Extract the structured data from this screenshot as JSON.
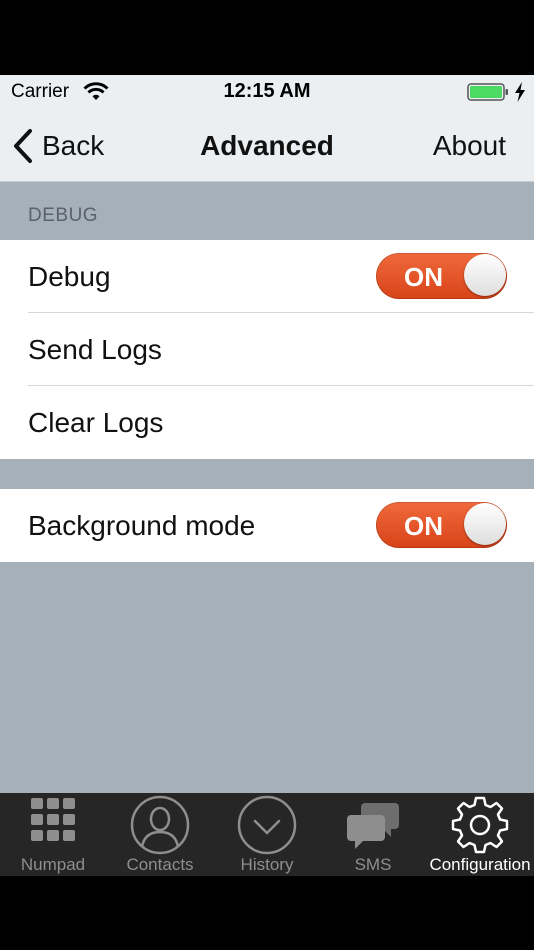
{
  "status": {
    "carrier": "Carrier",
    "time": "12:15 AM"
  },
  "nav": {
    "back_label": "Back",
    "title": "Advanced",
    "about_label": "About"
  },
  "section": {
    "header": "DEBUG"
  },
  "debug_group": {
    "debug": {
      "label": "Debug",
      "toggle": "ON"
    },
    "send_logs": {
      "label": "Send Logs"
    },
    "clear_logs": {
      "label": "Clear Logs"
    }
  },
  "background_group": {
    "background_mode": {
      "label": "Background mode",
      "toggle": "ON"
    }
  },
  "tabs": [
    {
      "label": "Numpad",
      "icon": "numpad-icon"
    },
    {
      "label": "Contacts",
      "icon": "contacts-icon"
    },
    {
      "label": "History",
      "icon": "history-icon"
    },
    {
      "label": "SMS",
      "icon": "sms-icon"
    },
    {
      "label": "Configuration",
      "icon": "gear-icon",
      "active": true
    }
  ],
  "colors": {
    "toggle_on": "#e2522a",
    "background": "#a6b0b9",
    "tabbar": "#262626",
    "battery": "#4cd964"
  }
}
